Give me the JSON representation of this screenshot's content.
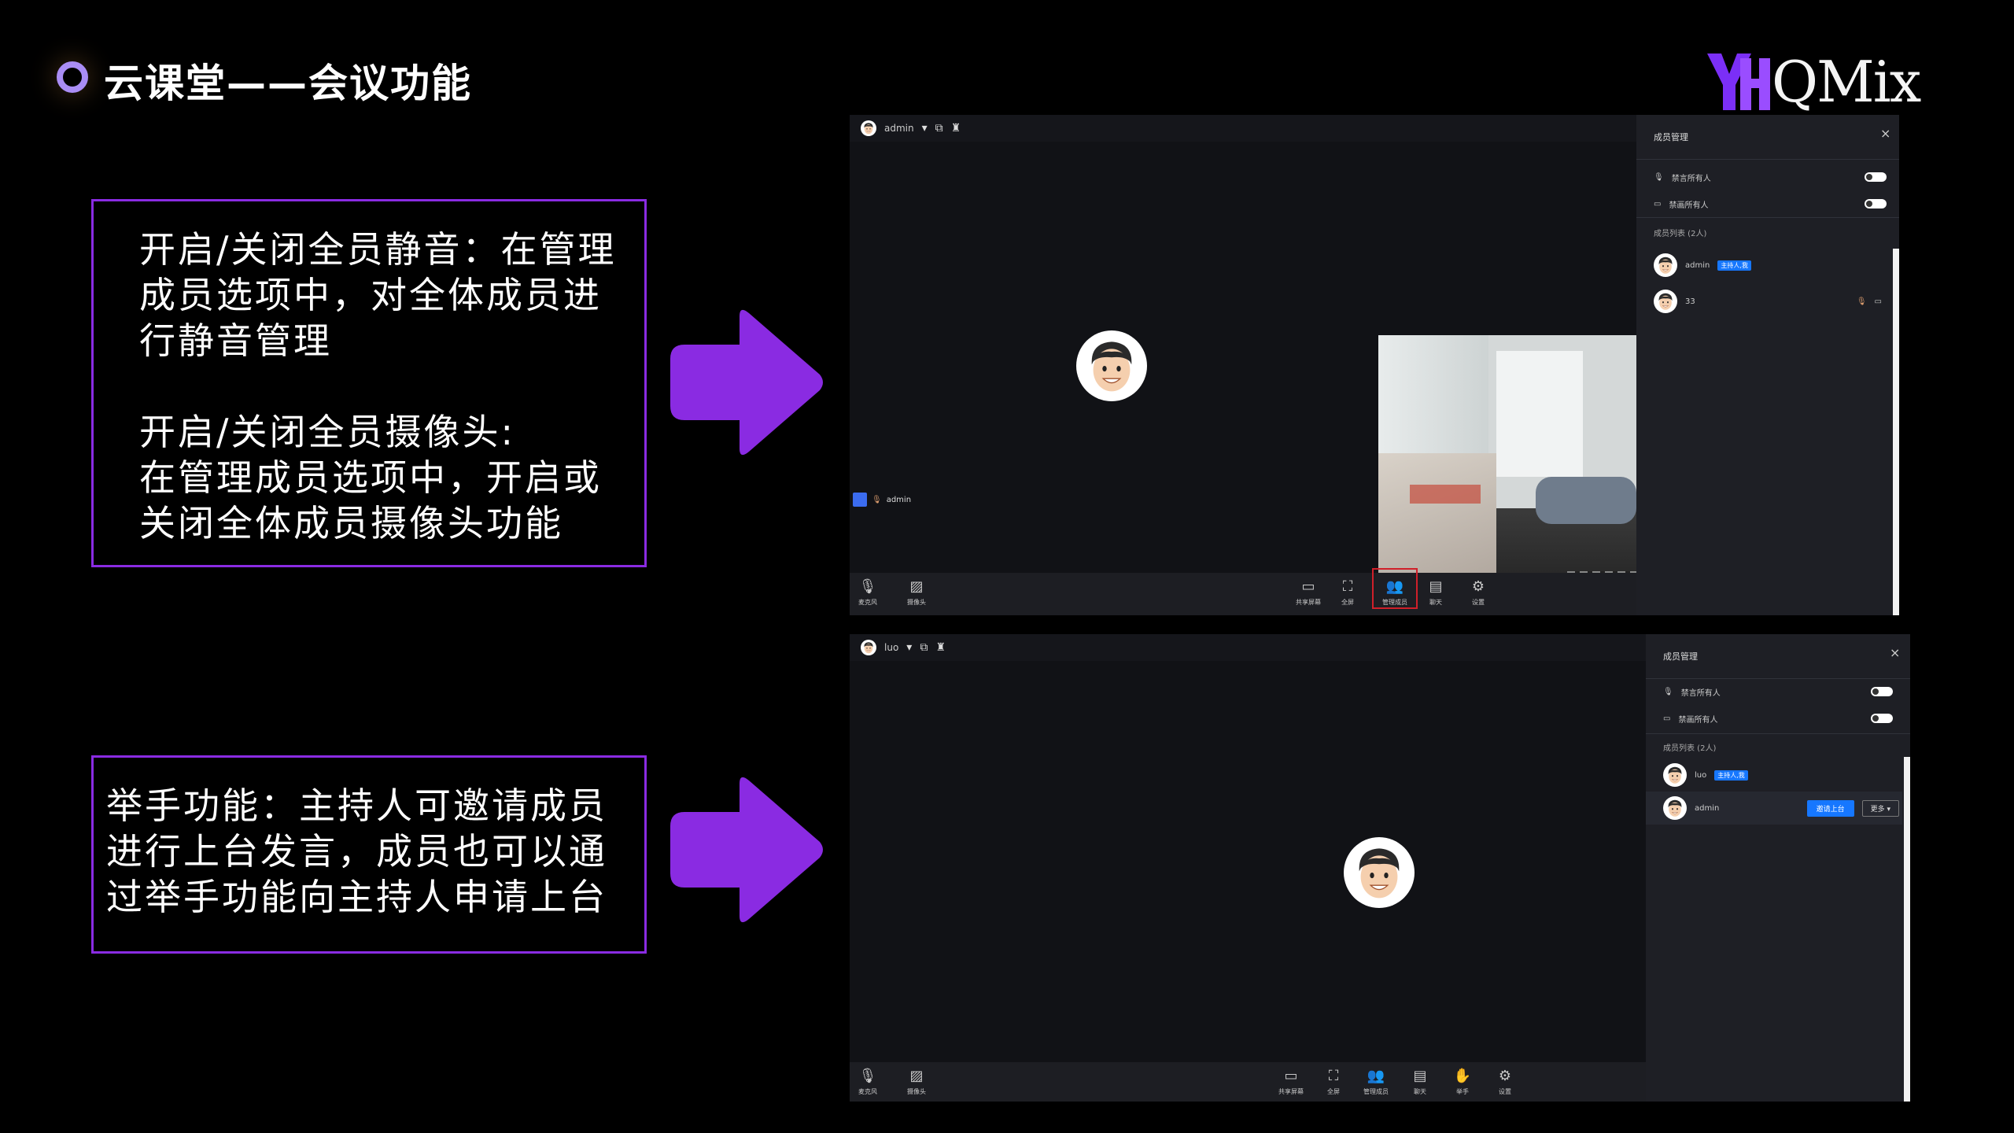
{
  "header": {
    "title": "云课堂——会议功能",
    "logo": {
      "mark": "YH",
      "text": "QMix"
    }
  },
  "panel_top": {
    "p1": [
      "开启/关闭全员静音：在管理",
      "成员选项中，对全体成员进",
      "行静音管理"
    ],
    "p2": [
      "开启/关闭全员摄像头:",
      "在管理成员选项中，开启或",
      "关闭全体成员摄像头功能"
    ]
  },
  "panel_bottom": {
    "p1": [
      "举手功能：主持人可邀请成员",
      "进行上台发言，成员也可以通",
      "过举手功能向主持人申请上台"
    ]
  },
  "colors": {
    "accent": "#8a2be2",
    "arrow": "#8a2be2",
    "highlight": "#d0202a",
    "badge": "#1677ff"
  },
  "screen1": {
    "user": "admin",
    "tile_name": "admin",
    "video_name": "33",
    "toolbar_left": [
      {
        "icon": "mic-icon",
        "label": "麦克风"
      },
      {
        "icon": "camera-off-icon",
        "label": "摄像头"
      }
    ],
    "toolbar_right": [
      {
        "icon": "screen-share-icon",
        "label": "共享屏幕"
      },
      {
        "icon": "fullscreen-icon",
        "label": "全屏"
      },
      {
        "icon": "members-icon",
        "label": "管理成员"
      },
      {
        "icon": "chat-icon",
        "label": "聊天"
      },
      {
        "icon": "gear-icon",
        "label": "设置"
      }
    ],
    "member_panel": {
      "title": "成员管理",
      "mute_all": "禁言所有人",
      "camera_all": "禁画所有人",
      "list_title": "成员列表 (2人)",
      "members": [
        {
          "name": "admin",
          "badge": "主持人,我"
        },
        {
          "name": "33"
        }
      ]
    }
  },
  "screen2": {
    "user": "luo",
    "toolbar_left": [
      {
        "icon": "mic-icon",
        "label": "麦克风"
      },
      {
        "icon": "camera-off-icon",
        "label": "摄像头"
      }
    ],
    "toolbar_right": [
      {
        "icon": "screen-share-icon",
        "label": "共享屏幕"
      },
      {
        "icon": "fullscreen-icon",
        "label": "全屏"
      },
      {
        "icon": "members-icon",
        "label": "管理成员"
      },
      {
        "icon": "chat-icon",
        "label": "聊天"
      },
      {
        "icon": "raise-hand-icon",
        "label": "举手"
      },
      {
        "icon": "gear-icon",
        "label": "设置"
      }
    ],
    "member_panel": {
      "title": "成员管理",
      "mute_all": "禁言所有人",
      "camera_all": "禁画所有人",
      "list_title": "成员列表 (2人)",
      "members": [
        {
          "name": "luo",
          "badge": "主持人,我"
        },
        {
          "name": "admin",
          "invite": "邀请上台",
          "more": "更多"
        }
      ]
    }
  }
}
